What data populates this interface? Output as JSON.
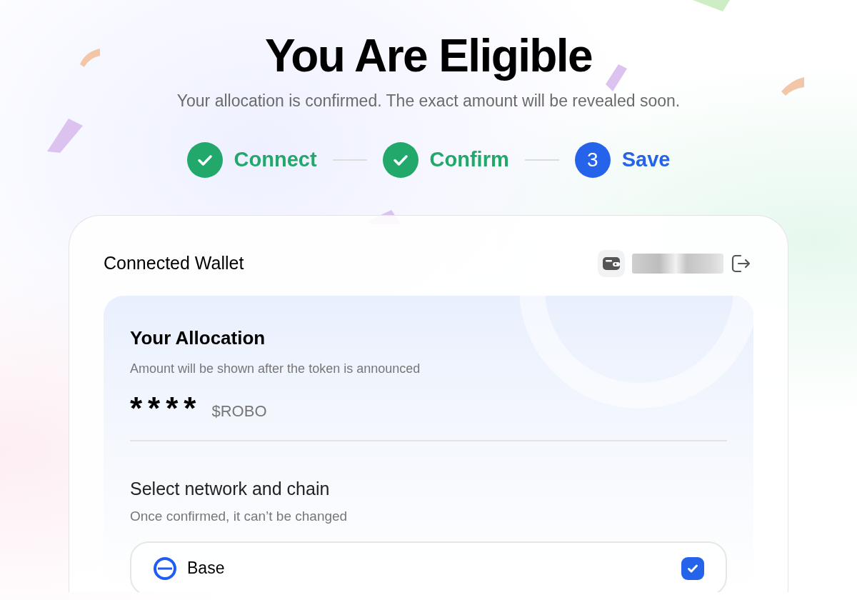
{
  "header": {
    "title": "You Are Eligible",
    "subtitle": "Your allocation is confirmed. The exact amount will be revealed soon."
  },
  "steps": [
    {
      "label": "Connect",
      "completed": true
    },
    {
      "label": "Confirm",
      "completed": true
    },
    {
      "label": "Save",
      "number": "3",
      "completed": false
    }
  ],
  "wallet": {
    "title": "Connected Wallet"
  },
  "allocation": {
    "title": "Your Allocation",
    "note": "Amount will be shown after the token is announced",
    "amount": "****",
    "token": "$ROBO"
  },
  "network": {
    "title": "Select network and chain",
    "note": "Once confirmed, it can’t be changed",
    "options": [
      {
        "label": "Base",
        "checked": true
      }
    ]
  }
}
